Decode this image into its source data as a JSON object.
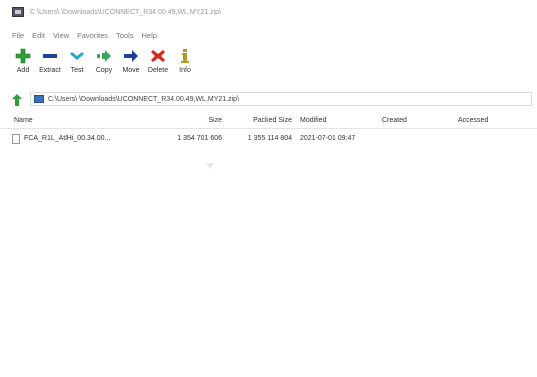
{
  "window": {
    "title": "C:\\Users\\          \\Downloads\\UCONNECT_R34.00.49,WL,MY21.zip\\"
  },
  "menu": [
    "File",
    "Edit",
    "View",
    "Favorites",
    "Tools",
    "Help"
  ],
  "toolbar": [
    {
      "label": "Add",
      "icon": "add-icon",
      "color": "#2e9e3a"
    },
    {
      "label": "Extract",
      "icon": "extract-icon",
      "color": "#1f3f99"
    },
    {
      "label": "Test",
      "icon": "test-icon",
      "color": "#2aa6c6"
    },
    {
      "label": "Copy",
      "icon": "copy-icon",
      "color": "#38a856"
    },
    {
      "label": "Move",
      "icon": "move-icon",
      "color": "#1f3f99"
    },
    {
      "label": "Delete",
      "icon": "delete-icon",
      "color": "#d8281e"
    },
    {
      "label": "Info",
      "icon": "info-icon",
      "color": "#b59a25"
    }
  ],
  "address": {
    "value": "C:\\Users\\          \\Downloads\\UCONNECT_R34.00.49,WL,MY21.zip\\"
  },
  "columns": [
    "Name",
    "Size",
    "Packed Size",
    "Modified",
    "Created",
    "Accessed"
  ],
  "files": [
    {
      "name": "FCA_R1L_AtlHi_00.34.00...",
      "size": "1 354 701 606",
      "packed": "1 355 114 804",
      "modified": "2021-07-01 09:47",
      "created": "",
      "accessed": ""
    }
  ]
}
